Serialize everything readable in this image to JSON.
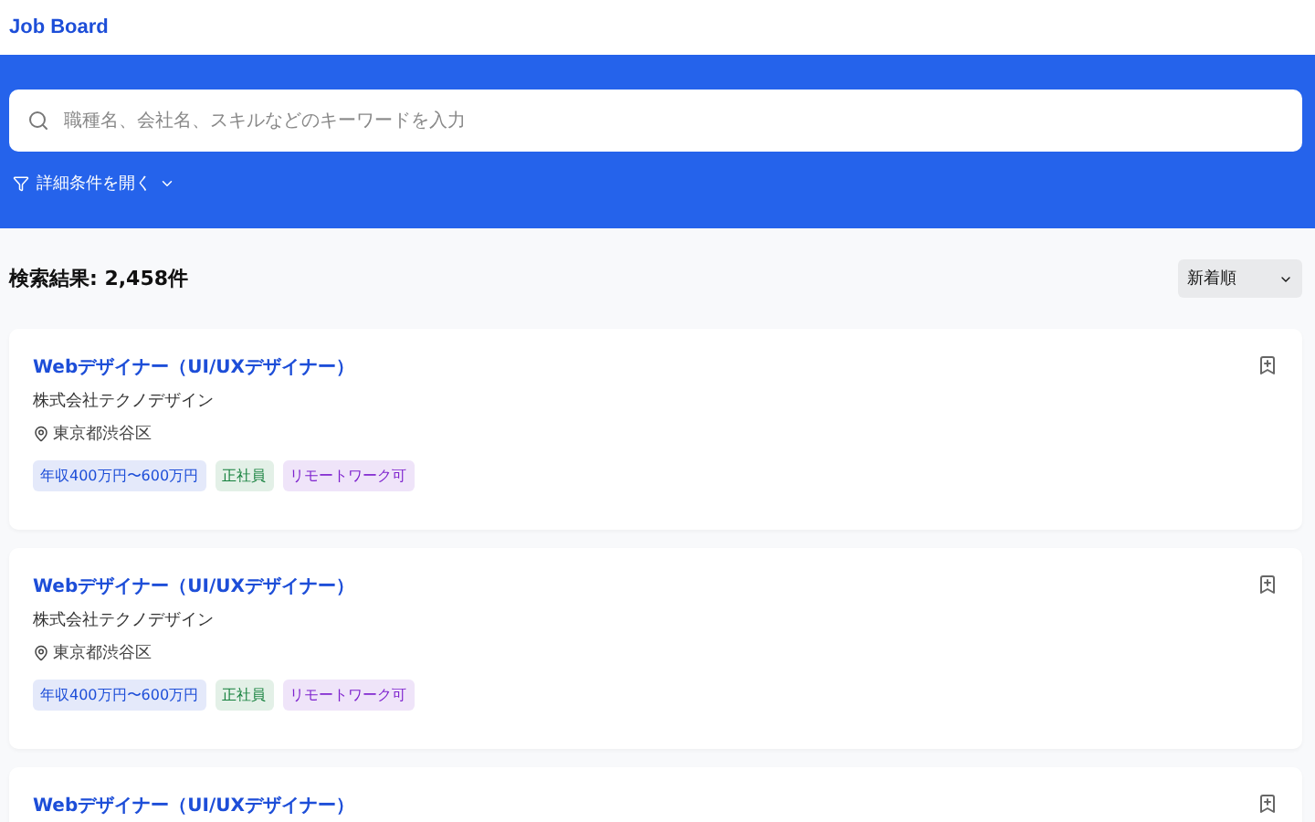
{
  "header": {
    "title": "Job Board"
  },
  "search": {
    "placeholder": "職種名、会社名、スキルなどのキーワードを入力"
  },
  "filter_toggle": {
    "label": "詳細条件を開く",
    "expanded": false
  },
  "results": {
    "count_label": "検索結果: 2,458件",
    "sort": {
      "value": "新着順"
    }
  },
  "jobs": [
    {
      "title": "Webデザイナー（UI/UXデザイナー）",
      "company": "株式会社テクノデザイン",
      "location": "東京都渋谷区",
      "bookmarked": false,
      "tags": [
        {
          "label": "年収400万円〜600万円",
          "color": "#1d4ed8"
        },
        {
          "label": "正社員",
          "color": "#15803d"
        },
        {
          "label": "リモートワーク可",
          "color": "#7e22ce"
        }
      ]
    },
    {
      "title": "Webデザイナー（UI/UXデザイナー）",
      "company": "株式会社テクノデザイン",
      "location": "東京都渋谷区",
      "bookmarked": false,
      "tags": [
        {
          "label": "年収400万円〜600万円",
          "color": "#1d4ed8"
        },
        {
          "label": "正社員",
          "color": "#15803d"
        },
        {
          "label": "リモートワーク可",
          "color": "#7e22ce"
        }
      ]
    },
    {
      "title": "Webデザイナー（UI/UXデザイナー）",
      "bookmarked": false
    }
  ]
}
